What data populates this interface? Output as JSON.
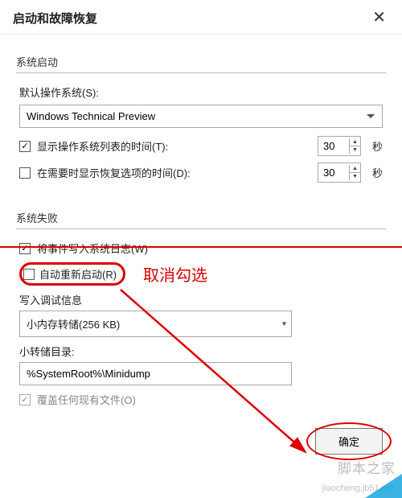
{
  "titlebar": {
    "title": "启动和故障恢复"
  },
  "startup": {
    "group_title": "系统启动",
    "default_os_label": "默认操作系统(S):",
    "default_os_value": "Windows Technical Preview",
    "show_os_list_label": "显示操作系统列表的时间(T):",
    "show_os_list_checked": true,
    "show_os_list_seconds": "30",
    "show_recovery_label": "在需要时显示恢复选项的时间(D):",
    "show_recovery_checked": false,
    "show_recovery_seconds": "30",
    "seconds_unit": "秒"
  },
  "failure": {
    "group_title": "系统失败",
    "write_event_label": "将事件写入系统日志(W)",
    "write_event_checked": true,
    "auto_restart_label": "自动重新启动(R)",
    "auto_restart_checked": false,
    "annotation": "取消勾选",
    "debug_info_label": "写入调试信息",
    "debug_info_value": "小内存转储(256 KB)",
    "dump_dir_label": "小转储目录:",
    "dump_dir_value": "%SystemRoot%\\Minidump",
    "overwrite_label": "覆盖任何现有文件(O)",
    "overwrite_checked": true
  },
  "footer": {
    "ok": "确定"
  },
  "watermark": {
    "line1": "脚本之家",
    "line2": "jiaocheng.jb51.net"
  }
}
